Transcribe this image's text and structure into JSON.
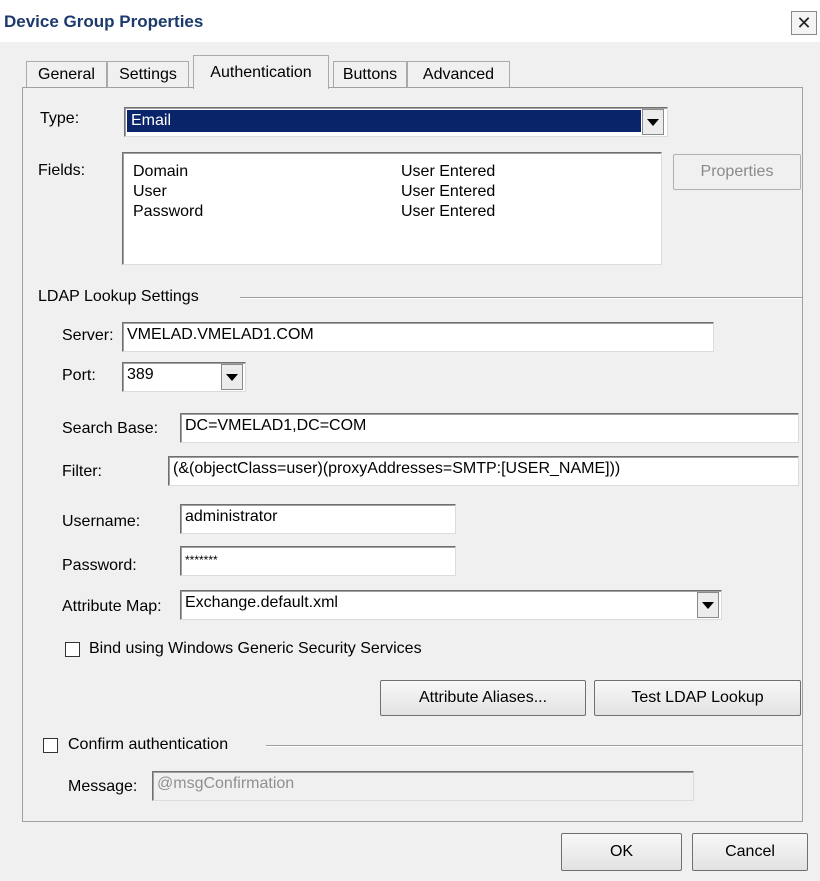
{
  "window": {
    "title": "Device Group Properties",
    "close_glyph": "✕"
  },
  "tabs": [
    {
      "label": "General"
    },
    {
      "label": "Settings"
    },
    {
      "label": "Authentication"
    },
    {
      "label": "Buttons"
    },
    {
      "label": "Advanced"
    }
  ],
  "auth": {
    "type_label": "Type:",
    "type_value": "Email",
    "fields_label": "Fields:",
    "fields": [
      {
        "name": "Domain",
        "value": "User Entered"
      },
      {
        "name": "User",
        "value": "User Entered"
      },
      {
        "name": "Password",
        "value": "User Entered"
      }
    ],
    "properties_button": "Properties"
  },
  "ldap": {
    "section_title": "LDAP  Lookup Settings",
    "server_label": "Server:",
    "server_value": "VMELAD.VMELAD1.COM",
    "port_label": "Port:",
    "port_value": "389",
    "search_base_label": "Search Base:",
    "search_base_value": "DC=VMELAD1,DC=COM",
    "filter_label": "Filter:",
    "filter_value": "(&(objectClass=user)(proxyAddresses=SMTP:[USER_NAME]))",
    "username_label": "Username:",
    "username_value": "administrator",
    "password_label": "Password:",
    "password_value": "*******",
    "attribute_map_label": "Attribute Map:",
    "attribute_map_value": "Exchange.default.xml",
    "bind_checkbox_label": "Bind using Windows Generic Security Services",
    "bind_checked": false,
    "attribute_aliases_button": "Attribute Aliases...",
    "test_lookup_button": "Test LDAP Lookup"
  },
  "confirm": {
    "checkbox_label": "Confirm authentication",
    "checked": false,
    "message_label": "Message:",
    "message_value": "@msgConfirmation"
  },
  "footer": {
    "ok_button": "OK",
    "cancel_button": "Cancel"
  },
  "colors": {
    "selection_bg": "#0a246a",
    "title_text": "#1c3a6b"
  }
}
